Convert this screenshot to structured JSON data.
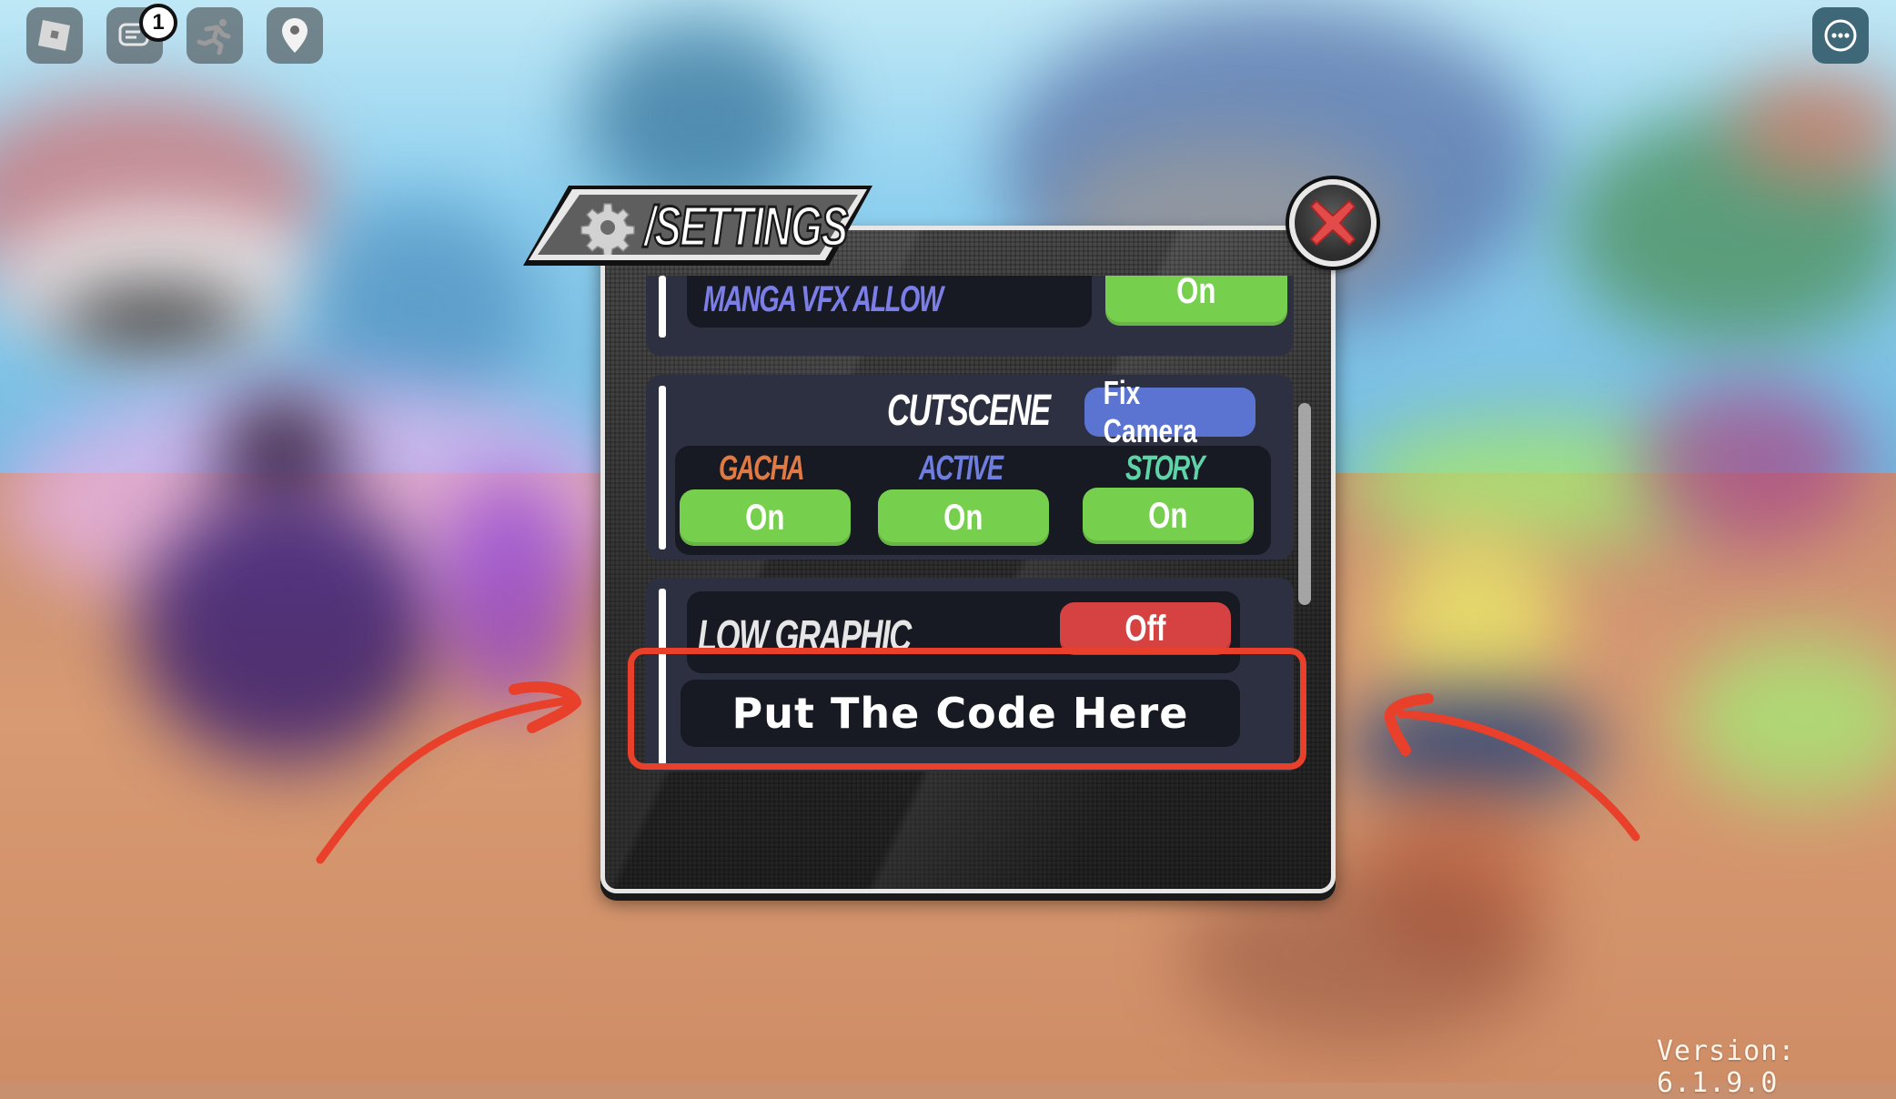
{
  "top_bar": {
    "buttons": [
      {
        "icon": "roblox-logo-icon"
      },
      {
        "icon": "chat-icon",
        "badge": "1"
      },
      {
        "icon": "emote-running-icon"
      },
      {
        "icon": "location-pin-icon"
      }
    ],
    "menu_icon": "more-options-icon"
  },
  "settings": {
    "title": "/SETTINGS",
    "title_icon": "gear-icon",
    "close_icon": "close-x-icon",
    "rows": {
      "manga_vfx": {
        "label": "MANGA VFX ALLOW",
        "value": "On"
      },
      "cutscene": {
        "label": "CUTSCENE",
        "fix_camera_label": "Fix Camera",
        "options": [
          {
            "label": "GACHA",
            "value": "On",
            "color": "#e07a45"
          },
          {
            "label": "ACTIVE",
            "value": "On",
            "color": "#6f7ddf"
          },
          {
            "label": "STORY",
            "value": "On",
            "color": "#5fd3a8"
          }
        ]
      },
      "low_graphic": {
        "label": "LOW GRAPHIC",
        "value": "Off"
      },
      "code": {
        "placeholder": "Put The Code Here"
      }
    }
  },
  "colors": {
    "on": "#76d04e",
    "off": "#d64141",
    "fix_camera": "#5b74d2",
    "manga_label": "#7c7ee8",
    "annotation": "#e8402a"
  },
  "version_text": "Version: 6.1.9.0"
}
